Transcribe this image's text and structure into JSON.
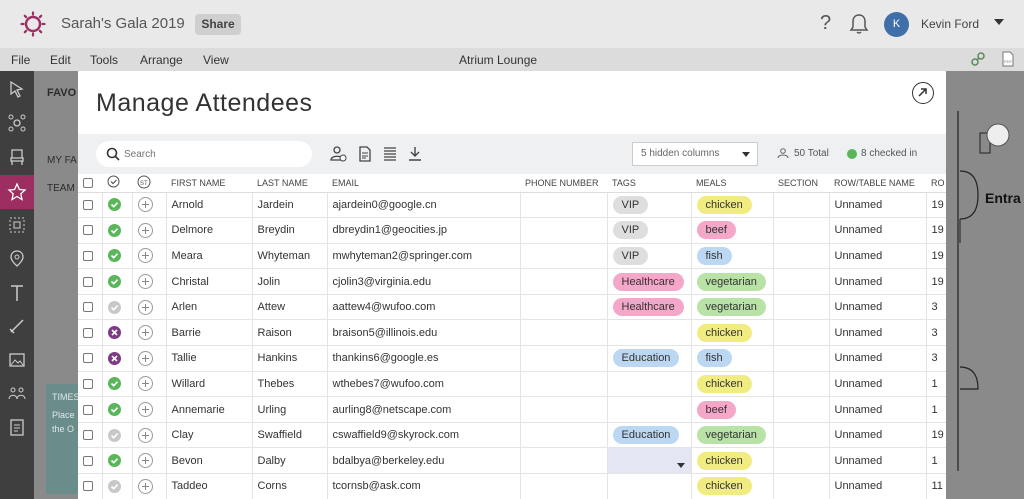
{
  "app": {
    "title": "Sarah's Gala 2019",
    "share_label": "Share"
  },
  "user": {
    "initial": "K",
    "name": "Kevin Ford"
  },
  "menu": {
    "items": [
      "File",
      "Edit",
      "Tools",
      "Arrange",
      "View"
    ],
    "venue": "Atrium Lounge"
  },
  "sidepanel": {
    "favorites": "FAVO",
    "my_favs": "MY FA",
    "team": "TEAM",
    "card_text1": "TIMES",
    "card_text2": "Place",
    "card_text3": "the O"
  },
  "canvas": {
    "label": "Entra"
  },
  "modal": {
    "title": "Manage Attendees",
    "search_placeholder": "Search",
    "hidden_columns": "5 hidden columns",
    "total": "50 Total",
    "checked_in": "8 checked in",
    "columns": [
      "",
      "",
      "",
      "FIRST NAME",
      "LAST NAME",
      "EMAIL",
      "PHONE NUMBER",
      "TAGS",
      "MEALS",
      "SECTION",
      "ROW/TABLE NAME",
      "RO"
    ]
  },
  "rows": [
    {
      "status": "checked",
      "first": "Arnold",
      "last": "Jardein",
      "email": "ajardein0@google.cn",
      "tag": "VIP",
      "tag_color": "gray",
      "meal": "chicken",
      "meal_color": "yellow",
      "table": "Unnamed",
      "row": "19"
    },
    {
      "status": "checked",
      "first": "Delmore",
      "last": "Breydin",
      "email": "dbreydin1@geocities.jp",
      "tag": "VIP",
      "tag_color": "gray",
      "meal": "beef",
      "meal_color": "pink",
      "table": "Unnamed",
      "row": "19"
    },
    {
      "status": "checked",
      "first": "Meara",
      "last": "Whyteman",
      "email": "mwhyteman2@springer.com",
      "tag": "VIP",
      "tag_color": "gray",
      "meal": "fish",
      "meal_color": "blue",
      "table": "Unnamed",
      "row": "19"
    },
    {
      "status": "checked",
      "first": "Christal",
      "last": "Jolin",
      "email": "cjolin3@virginia.edu",
      "tag": "Healthcare",
      "tag_color": "pink",
      "meal": "vegetarian",
      "meal_color": "green",
      "table": "Unnamed",
      "row": "19"
    },
    {
      "status": "unchecked",
      "first": "Arlen",
      "last": "Attew",
      "email": "aattew4@wufoo.com",
      "tag": "Healthcare",
      "tag_color": "pink",
      "meal": "vegetarian",
      "meal_color": "green",
      "table": "Unnamed",
      "row": "3"
    },
    {
      "status": "declined",
      "first": "Barrie",
      "last": "Raison",
      "email": "braison5@illinois.edu",
      "tag": "",
      "tag_color": "",
      "meal": "chicken",
      "meal_color": "yellow",
      "table": "Unnamed",
      "row": "3"
    },
    {
      "status": "declined",
      "first": "Tallie",
      "last": "Hankins",
      "email": "thankins6@google.es",
      "tag": "Education",
      "tag_color": "blue",
      "meal": "fish",
      "meal_color": "blue",
      "table": "Unnamed",
      "row": "3"
    },
    {
      "status": "checked",
      "first": "Willard",
      "last": "Thebes",
      "email": "wthebes7@wufoo.com",
      "tag": "",
      "tag_color": "",
      "meal": "chicken",
      "meal_color": "yellow",
      "table": "Unnamed",
      "row": "1"
    },
    {
      "status": "checked",
      "first": "Annemarie",
      "last": "Urling",
      "email": "aurling8@netscape.com",
      "tag": "",
      "tag_color": "",
      "meal": "beef",
      "meal_color": "pink",
      "table": "Unnamed",
      "row": "1"
    },
    {
      "status": "unchecked",
      "first": "Clay",
      "last": "Swaffield",
      "email": "cswaffield9@skyrock.com",
      "tag": "Education",
      "tag_color": "blue",
      "meal": "vegetarian",
      "meal_color": "green",
      "table": "Unnamed",
      "row": "19"
    },
    {
      "status": "checked",
      "first": "Bevon",
      "last": "Dalby",
      "email": "bdalbya@berkeley.edu",
      "tag": "",
      "tag_color": "select",
      "meal": "chicken",
      "meal_color": "yellow",
      "table": "Unnamed",
      "row": "1"
    },
    {
      "status": "unchecked",
      "first": "Taddeo",
      "last": "Corns",
      "email": "tcornsb@ask.com",
      "tag": "",
      "tag_color": "",
      "meal": "chicken",
      "meal_color": "yellow",
      "table": "Unnamed",
      "row": "11"
    }
  ],
  "colors": {
    "accent": "#9c2e62",
    "checked": "#5bb55b",
    "declined": "#7e3a85"
  }
}
